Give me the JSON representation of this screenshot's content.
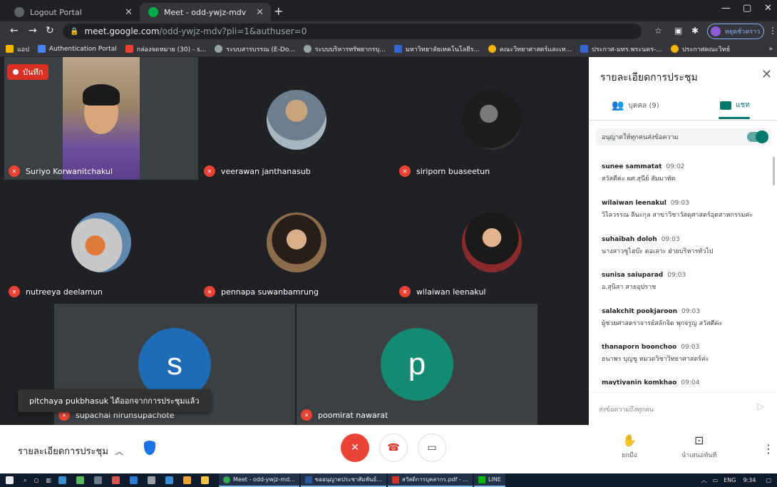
{
  "browser": {
    "tabs": [
      {
        "title": "Logout Portal",
        "active": false
      },
      {
        "title": "Meet - odd-ywjz-mdv",
        "active": true
      }
    ],
    "url_host": "meet.google.com",
    "url_path": "/odd-ywjz-mdv?pli=1&authuser=0",
    "profile_label": "หยุดชั่วคราว",
    "bookmarks": [
      "แอป",
      "Authentication Portal",
      "กล่องจดหมาย (30) - s...",
      "ระบบสารบรรณ (E-Do...",
      "ระบบบริหารทรัพยากรบุ...",
      "มหาวิทยาลัยเทคโนโลยีร...",
      "คณะวิทยาศาสตร์และเท...",
      "ประกาศ-มทร.พระนคร-...",
      "ประกาศคณะวิทย์"
    ]
  },
  "meet": {
    "record_label": "บันทึก",
    "participants": [
      {
        "name": "Suriyo Korwanitchakul"
      },
      {
        "name": "veerawan janthanasub"
      },
      {
        "name": "siriporn buaseetun"
      },
      {
        "name": "nutreeya deelamun"
      },
      {
        "name": "pennapa suwanbamrung"
      },
      {
        "name": "wilaiwan leenakul"
      },
      {
        "name": "supachai nirunsupachote",
        "initial": "s"
      },
      {
        "name": "poomirat nawarat",
        "initial": "p"
      }
    ],
    "toast": "pitchaya pukbhasuk ได้ออกจากการประชุมแล้ว",
    "colors": {
      "letter_s": "#1e6cb5",
      "letter_p": "#138a72",
      "mic_off": "#ea4335",
      "accent": "#00796b"
    }
  },
  "panel": {
    "title": "รายละเอียดการประชุม",
    "people_tab": "บุคคล (9)",
    "chat_tab": "แชท",
    "allow_label": "อนุญาตให้ทุกคนส่งข้อความ",
    "messages": [
      {
        "sender": "sunee sammatat",
        "time": "09:02",
        "text": "สวัสดีค่ะ ผศ.สุนีย์ สัมมาทัต"
      },
      {
        "sender": "wilaiwan leenakul",
        "time": "09:03",
        "text": "วิไลวรรณ ลีนะกุล สาขาวิชาวัสดุศาสตร์อุตสาหกรรมค่ะ"
      },
      {
        "sender": "suhaibah doloh",
        "time": "09:03",
        "text": "นางสาวซูไฮบ๊ะ ดอเลาะ ฝ่ายบริหารทั่วไป"
      },
      {
        "sender": "sunisa saiuparad",
        "time": "09:03",
        "text": "อ.สุนิสา สายอุปราช"
      },
      {
        "sender": "salakchit pookjaroon",
        "time": "09:03",
        "text": "ผู้ช่วยศาสตราจารย์สลักจิต พุกจรูญ สวัสดีค่ะ"
      },
      {
        "sender": "thanaporn boonchoo",
        "time": "09:03",
        "text": "ธนาพร บุญชู หมวดวิชาวิทยาศาสตร์ค่ะ"
      },
      {
        "sender": "maytiyanin komkhao",
        "time": "09:04",
        "text": ""
      }
    ],
    "composer_placeholder": "ส่งข้อความถึงทุกคน"
  },
  "bottom": {
    "details_label": "รายละเอียดการประชุม",
    "raise_hand": "ยกมือ",
    "present": "นำเสนอทันที"
  },
  "taskbar": {
    "apps": [
      "Meet - odd-ywjz-md...",
      "ขออนุญาตประชาสัมพันธ์...",
      "สวัสดิการบุคลากร.pdf - ...",
      "LINE"
    ],
    "lang": "ENG",
    "clock": "9:34"
  }
}
